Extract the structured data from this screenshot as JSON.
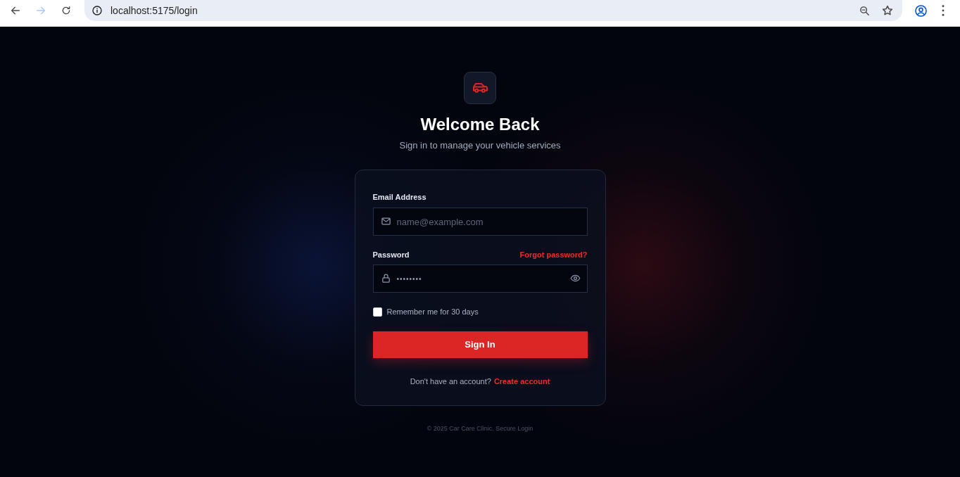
{
  "browser": {
    "nav": [
      {
        "kind": "back",
        "disabled": false
      },
      {
        "kind": "forward",
        "disabled": true
      },
      {
        "kind": "reload",
        "disabled": false
      }
    ],
    "url": "localhost:5175/login"
  },
  "heading": "Welcome Back",
  "subtitle": "Sign in to manage your vehicle services",
  "form": {
    "fields": [
      {
        "kind": "email",
        "label": "Email Address",
        "placeholder": "name@example.com"
      },
      {
        "kind": "password",
        "label": "Password",
        "link": "Forgot password?",
        "value": "••••••••"
      }
    ],
    "remember": {
      "label": "Remember me for 30 days",
      "checked": false
    },
    "submit": "Sign In",
    "signup": {
      "prompt": "Don't have an account?",
      "link": "Create account"
    }
  },
  "footer": "© 2025 Car Care Clinic. Secure Login"
}
